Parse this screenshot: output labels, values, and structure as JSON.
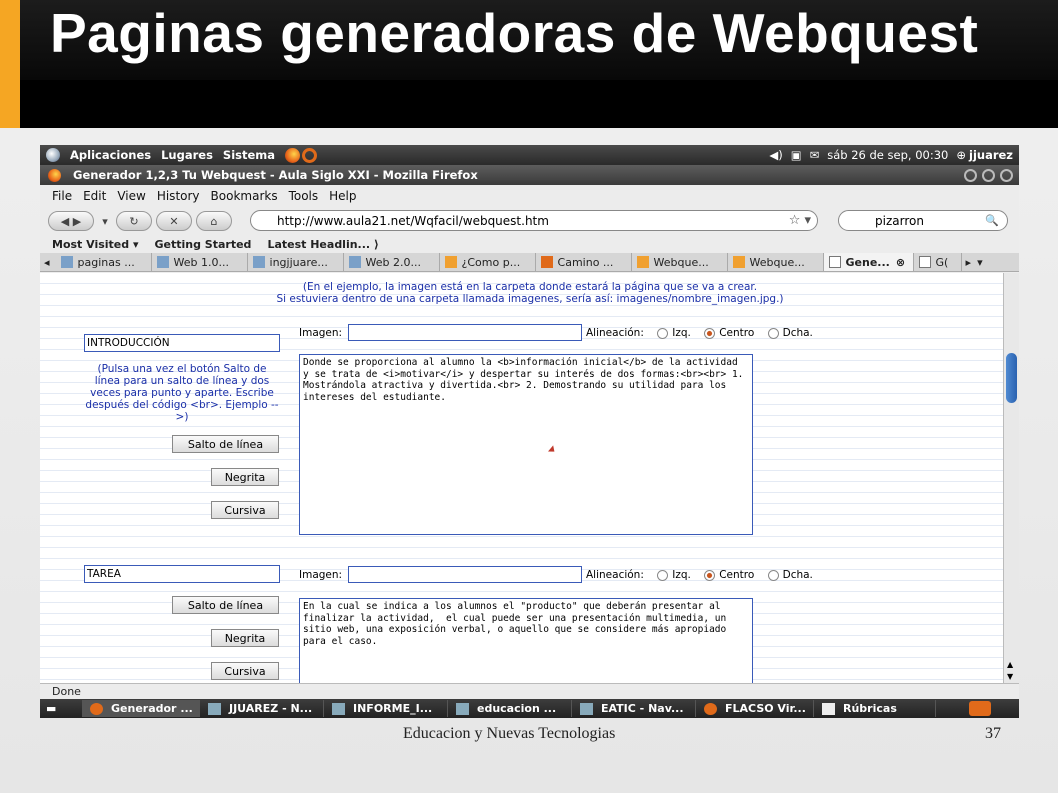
{
  "slide": {
    "title": "Paginas generadoras de Webquest",
    "footer": "Educacion y Nuevas Tecnologias",
    "page_number": "37"
  },
  "gnome_panel": {
    "menus": [
      "Aplicaciones",
      "Lugares",
      "Sistema"
    ],
    "clock": "sáb 26 de sep, 00:30",
    "user": "jjuarez"
  },
  "window": {
    "title": "Generador 1,2,3 Tu Webquest - Aula Siglo XXI - Mozilla Firefox"
  },
  "menubar": [
    "File",
    "Edit",
    "View",
    "History",
    "Bookmarks",
    "Tools",
    "Help"
  ],
  "navigation": {
    "url": "http://www.aula21.net/Wqfacil/webquest.htm",
    "search_value": "pizarron"
  },
  "bookmarks": [
    "Most Visited ▾",
    "Getting Started",
    "Latest Headlin... ⟩"
  ],
  "tabs": [
    "paginas ...",
    "Web 1.0...",
    "ingjjuare...",
    "Web 2.0...",
    "¿Como p...",
    "Camino ...",
    "Webque...",
    "Webque...",
    "Gene...",
    "G("
  ],
  "page": {
    "note_line1": "(En el ejemplo, la imagen está en la carpeta donde estará la página que se va a crear.",
    "note_line2": "Si estuviera dentro de una carpeta llamada imagenes, sería así: imagenes/nombre_imagen.jpg.)",
    "image_label": "Imagen:",
    "align_label": "Alineación:",
    "align_options": [
      "Izq.",
      "Centro",
      "Dcha."
    ],
    "help_text": "(Pulsa una vez el botón Salto de línea para un salto de línea y dos veces para punto y aparte. Escribe después del código <br>. Ejemplo -->)",
    "button_break": "Salto de línea",
    "button_bold": "Negrita",
    "button_italic": "Cursiva",
    "sections": [
      {
        "name": "INTRODUCCIÓN",
        "text": "Donde se proporciona al alumno la <b>información inicial</b> de la actividad y se trata de <i>motivar</i> y despertar su interés de dos formas:<br><br> 1. Mostrándola atractiva y divertida.<br> 2. Demostrando su utilidad para los intereses del estudiante."
      },
      {
        "name": "TAREA",
        "text": "En la cual se indica a los alumnos el \"producto\" que deberán presentar al finalizar la actividad,  el cual puede ser una presentación multimedia, un sitio web, una exposición verbal, o aquello que se considere más apropiado para el caso."
      }
    ]
  },
  "status": "Done",
  "taskbar": [
    "Generador ...",
    "JJUAREZ - N...",
    "INFORME_I...",
    "educacion ...",
    "EATIC - Nav...",
    "FLACSO Vir...",
    "Rúbricas"
  ]
}
